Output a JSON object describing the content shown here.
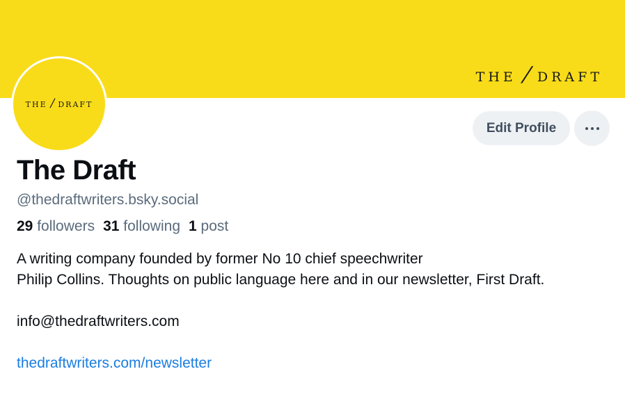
{
  "banner": {
    "logo_left": "THE",
    "logo_slash": "/",
    "logo_right": "DRAFT",
    "color": "#f9dc19"
  },
  "avatar": {
    "logo_left": "THE",
    "logo_slash": "/",
    "logo_right": "DRAFT"
  },
  "actions": {
    "edit_label": "Edit Profile",
    "more_icon": "ellipsis-icon"
  },
  "profile": {
    "display_name": "The Draft",
    "handle": "@thedraftwriters.bsky.social"
  },
  "stats": {
    "followers_count": "29",
    "followers_label": "followers",
    "following_count": "31",
    "following_label": "following",
    "posts_count": "1",
    "posts_label": "post"
  },
  "bio": {
    "line1": "A writing company founded by former No 10 chief speechwriter",
    "line2": "Philip Collins. Thoughts on public language here and in our newsletter, First Draft.",
    "email": "info@thedraftwriters.com",
    "link": "thedraftwriters.com/newsletter"
  },
  "colors": {
    "brand_yellow": "#f9dc19",
    "link_blue": "#1a7ee0",
    "muted_text": "#5a6b7c"
  }
}
